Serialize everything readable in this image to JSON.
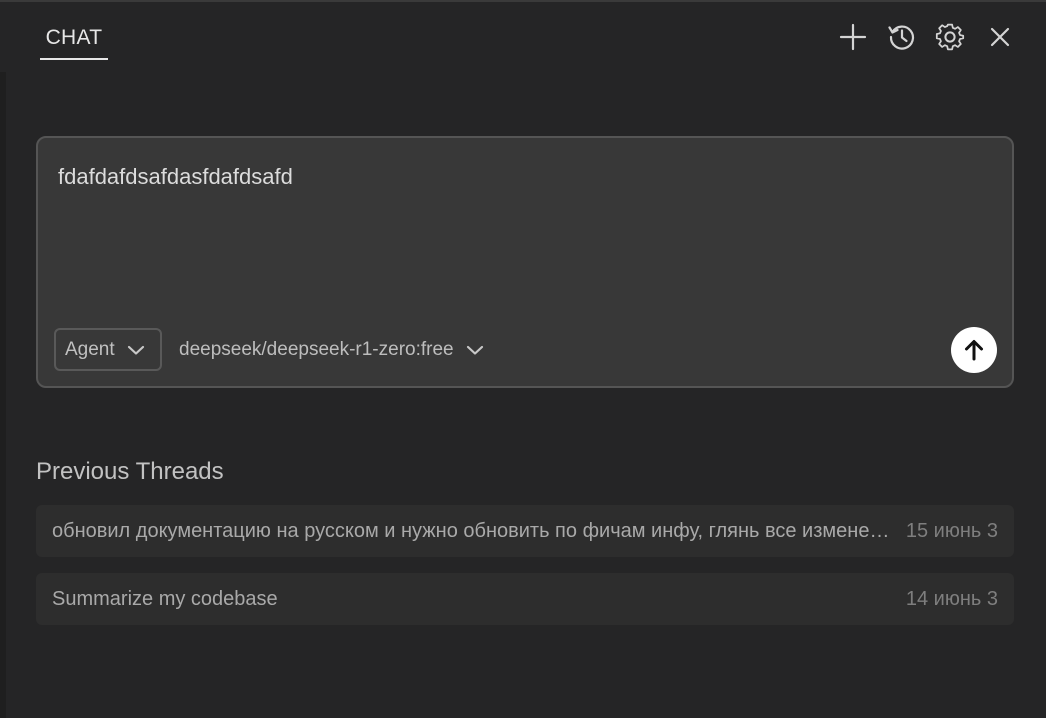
{
  "header": {
    "tab_label": "CHAT",
    "icons": [
      "plus-icon",
      "history-icon",
      "gear-icon",
      "close-icon"
    ]
  },
  "composer": {
    "input_value": "fdafdafdsafdasfdafdsafd",
    "mode_label": "Agent",
    "model_label": "deepseek/deepseek-r1-zero:free",
    "send_icon": "arrow-up-icon"
  },
  "threads": {
    "title": "Previous Threads",
    "items": [
      {
        "title": "обновил документацию на русском и нужно обновить по фичам инфу, глянь все изменения",
        "date": "15 июнь 3"
      },
      {
        "title": "Summarize my codebase",
        "date": "14 июнь 3"
      }
    ]
  },
  "colors": {
    "background": "#252526",
    "composer_bg": "#383838",
    "thread_bg": "#2d2d2d",
    "send_button": "#ffffff"
  }
}
